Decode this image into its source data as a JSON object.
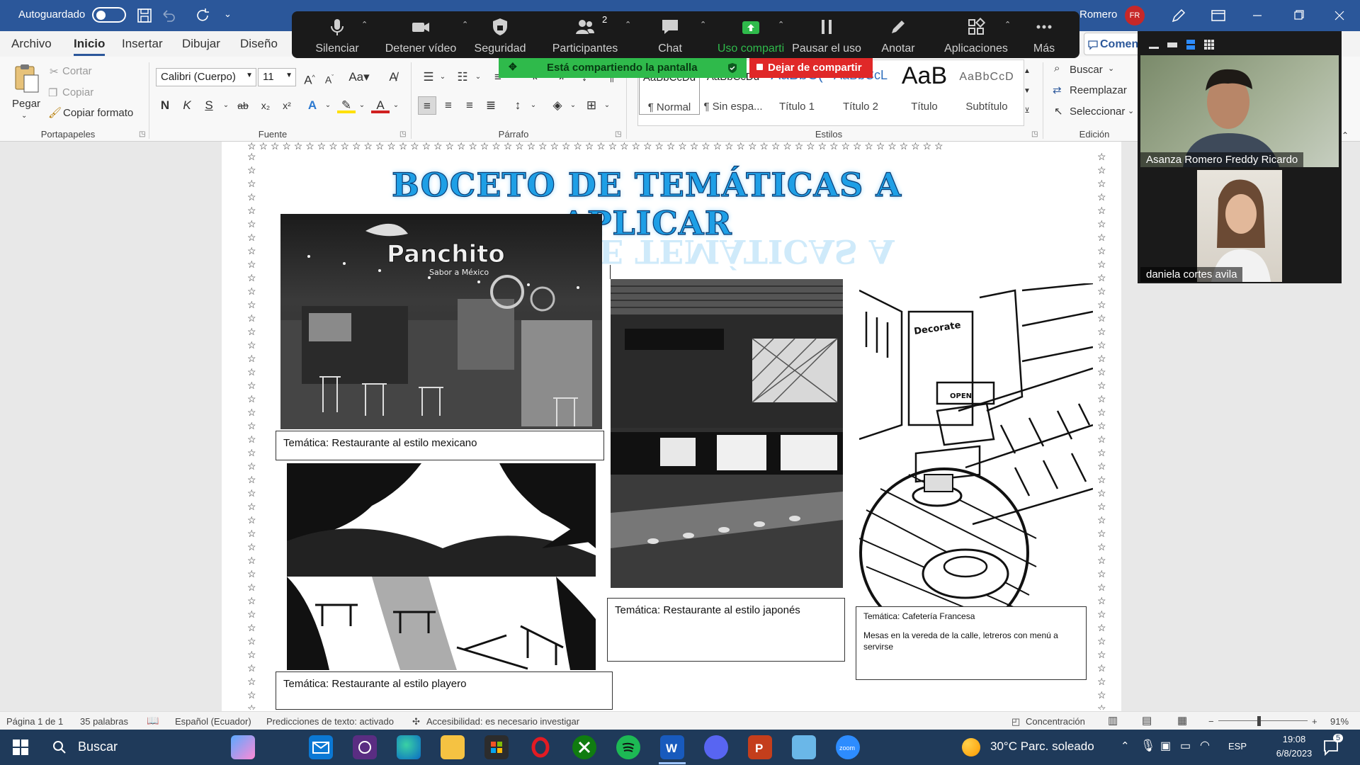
{
  "titlebar": {
    "autosave_label": "Autoguardado",
    "user_name": "Romero",
    "user_initials": "FR"
  },
  "tabs": [
    "Archivo",
    "Inicio",
    "Insertar",
    "Dibujar",
    "Diseño"
  ],
  "comment_button": "Comentar",
  "zoom_toolbar": {
    "mute": "Silenciar",
    "stop_video": "Detener vídeo",
    "security": "Seguridad",
    "participants": "Participantes",
    "participants_count": "2",
    "chat": "Chat",
    "share": "Uso comparti",
    "pause": "Pausar el uso",
    "annotate": "Anotar",
    "apps": "Aplicaciones",
    "more": "Más",
    "sharing_banner": "Está compartiendo la pantalla",
    "stop_share": "Dejar de compartir"
  },
  "ribbon": {
    "clipboard": {
      "paste": "Pegar",
      "cut": "Cortar",
      "copy": "Copiar",
      "format_painter": "Copiar formato",
      "group": "Portapapeles"
    },
    "font": {
      "family": "Calibri (Cuerpo)",
      "size": "11",
      "group": "Fuente",
      "bold": "N",
      "italic": "K",
      "underline": "S"
    },
    "paragraph": {
      "group": "Párrafo"
    },
    "styles": {
      "group": "Estilos",
      "items": [
        {
          "preview": "AaBbCcDd",
          "label": "¶ Normal"
        },
        {
          "preview": "AaBbCcDd",
          "label": "¶ Sin espa..."
        },
        {
          "preview": "AaBbC(",
          "label": "Título 1"
        },
        {
          "preview": "AaBbCcL",
          "label": "Título 2"
        },
        {
          "preview": "AaB",
          "label": "Título"
        },
        {
          "preview": "AaBbCcD",
          "label": "Subtítulo"
        }
      ]
    },
    "editing": {
      "find": "Buscar",
      "replace": "Reemplazar",
      "select": "Seleccionar",
      "group": "Edición"
    }
  },
  "document": {
    "title": "BOCETO DE TEMÁTICAS A APLICAR",
    "photo_sign_1": "Panchito",
    "photo_sign_2": "Sabor a México",
    "photo_sign_3": "Decorate",
    "photo_sign_4": "OPEN",
    "captions": {
      "mexican": "Temática: Restaurante al estilo mexicano",
      "beach": "Temática: Restaurante al estilo playero",
      "japanese": "Temática: Restaurante al estilo japonés",
      "french_title": "Temática: Cafetería Francesa",
      "french_desc": "Mesas en la vereda de la calle, letreros con menú a servirse"
    }
  },
  "participants": [
    {
      "name": "Asanza Romero Freddy Ricardo"
    },
    {
      "name": "daniela cortes avila"
    }
  ],
  "statusbar": {
    "page": "Página 1 de 1",
    "words": "35 palabras",
    "language": "Español (Ecuador)",
    "predictions": "Predicciones de texto: activado",
    "accessibility": "Accesibilidad: es necesario investigar",
    "focus": "Concentración",
    "zoom": "91%"
  },
  "taskbar": {
    "search": "Buscar",
    "weather": "30°C  Parc. soleado",
    "language": "ESP",
    "time": "19:08",
    "date": "6/8/2023",
    "notif_count": "5"
  }
}
